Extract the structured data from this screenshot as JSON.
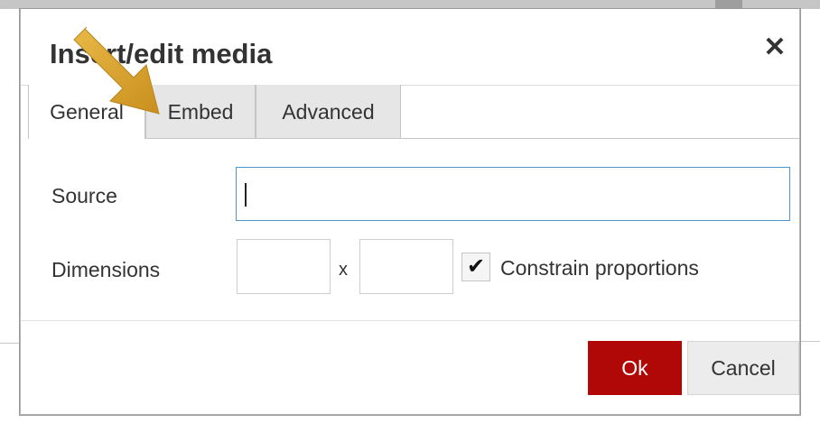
{
  "dialog": {
    "title": "Insert/edit media",
    "close_icon": "close-icon"
  },
  "tabs": [
    {
      "label": "General",
      "active": true
    },
    {
      "label": "Embed",
      "active": false
    },
    {
      "label": "Advanced",
      "active": false
    }
  ],
  "form": {
    "source_label": "Source",
    "source_value": "",
    "dimensions_label": "Dimensions",
    "width_value": "",
    "height_value": "",
    "separator": "x",
    "constrain_label": "Constrain proportions",
    "constrain_checked": true
  },
  "buttons": {
    "ok_label": "Ok",
    "cancel_label": "Cancel"
  },
  "colors": {
    "ok_button": "#b00707",
    "input_focus_border": "#4f96d0",
    "annotation_arrow": "#d9a532"
  },
  "icons": {
    "close": "close-icon",
    "check": "checkmark-icon",
    "annotation": "arrow-pointer-icon"
  }
}
